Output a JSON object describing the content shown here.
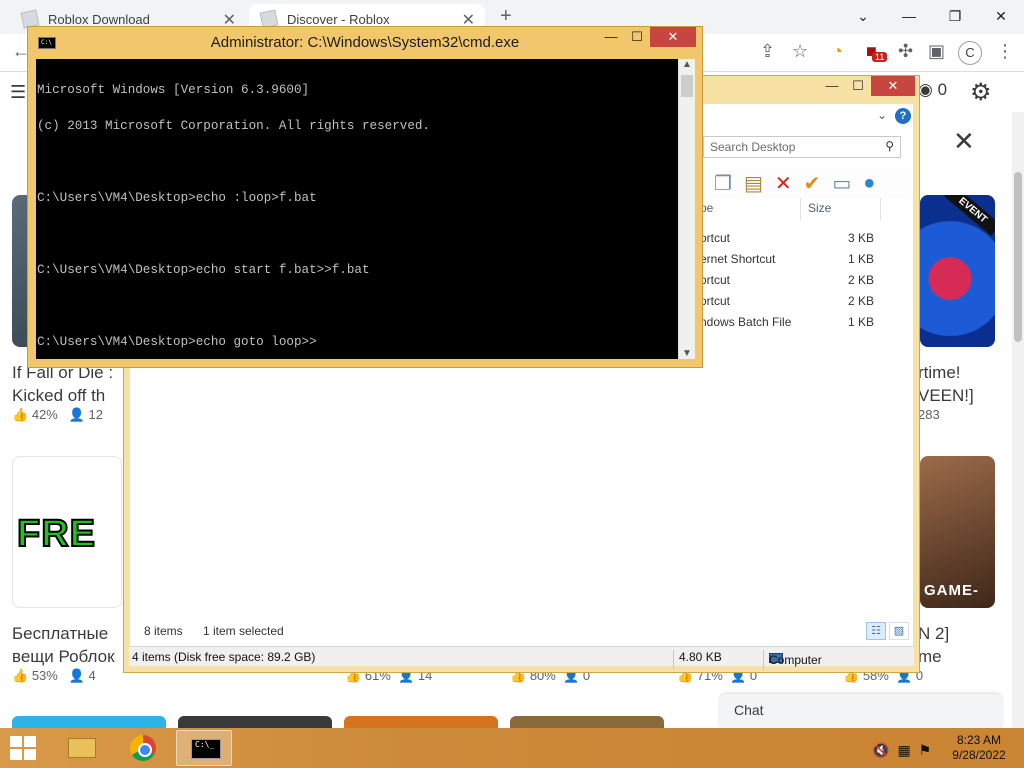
{
  "chrome": {
    "tabs": [
      {
        "label": "Roblox Download"
      },
      {
        "label": "Discover - Roblox"
      }
    ],
    "new_tab": "+",
    "window_controls": {
      "chevron": "⌄",
      "minimize": "—",
      "restore": "❐",
      "close": "✕"
    },
    "avatar_letter": "C",
    "extension_badge": "11"
  },
  "roblox": {
    "robux": "0",
    "games_row1": [
      {
        "title_line1": "If Fall or Die :",
        "title_line2": "Kicked off th",
        "rating": "42%",
        "players": "12"
      },
      {
        "title_line1": "rtime!",
        "title_line2": "VEEN!]",
        "players": "283"
      }
    ],
    "games_row2": [
      {
        "title_line1": "Бесплатные",
        "title_line2": "вещи Роблок",
        "rating": "53%",
        "players": "4"
      },
      {
        "title_line1": "N 2]",
        "title_line2": "me"
      }
    ],
    "row2_stats": [
      {
        "rating": "61%",
        "players": "14"
      },
      {
        "rating": "80%",
        "players": "0"
      },
      {
        "rating": "71%",
        "players": "0"
      },
      {
        "rating": "58%",
        "players": "0"
      }
    ],
    "card_free_text": "FRE",
    "card_event_tag": "EVENT",
    "card_game_text": "GAME-",
    "chat_label": "Chat"
  },
  "explorer": {
    "search_placeholder": "Search Desktop",
    "columns": {
      "type": "pe",
      "size": "Size"
    },
    "files": [
      {
        "type": "ortcut",
        "size": "3 KB"
      },
      {
        "type": "ernet Shortcut",
        "size": "1 KB"
      },
      {
        "type": "ortcut",
        "size": "2 KB"
      },
      {
        "type": "ortcut",
        "size": "2 KB"
      },
      {
        "type": "ndows Batch File",
        "size": "1 KB"
      }
    ],
    "status_items": "8 items",
    "status_selected": "1 item selected",
    "statusbar": {
      "items_free": "4 items (Disk free space: 89.2 GB)",
      "size": "4.80 KB",
      "location": "Computer"
    }
  },
  "cmd": {
    "title": "Administrator: C:\\Windows\\System32\\cmd.exe",
    "lines": [
      "Microsoft Windows [Version 6.3.9600]",
      "(c) 2013 Microsoft Corporation. All rights reserved.",
      "",
      "C:\\Users\\VM4\\Desktop>echo :loop>f.bat",
      "",
      "C:\\Users\\VM4\\Desktop>echo start f.bat>>f.bat",
      "",
      "C:\\Users\\VM4\\Desktop>echo goto loop>>"
    ]
  },
  "taskbar": {
    "time": "8:23 AM",
    "date": "9/28/2022"
  }
}
